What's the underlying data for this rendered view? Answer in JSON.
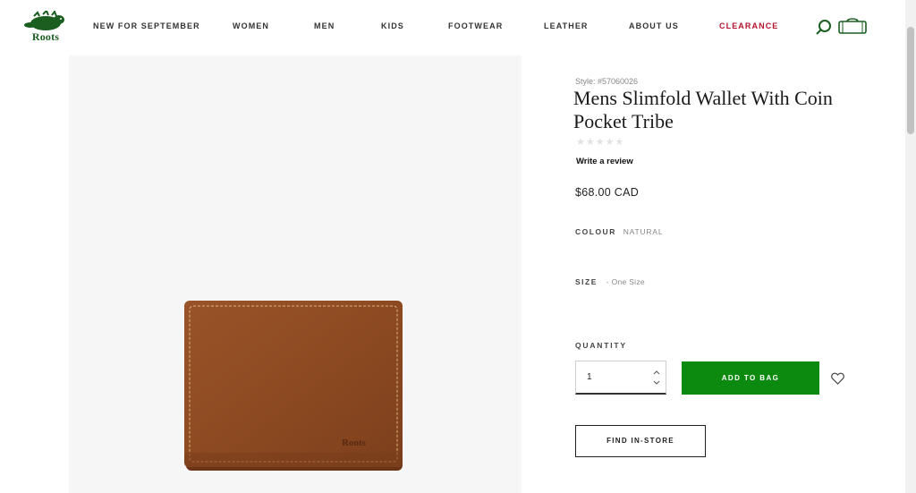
{
  "brand": {
    "logo_text": "Roots",
    "logo_color": "#1b5e20"
  },
  "nav": {
    "items": [
      {
        "label": "NEW FOR SEPTEMBER"
      },
      {
        "label": "WOMEN"
      },
      {
        "label": "MEN"
      },
      {
        "label": "KIDS"
      },
      {
        "label": "FOOTWEAR"
      },
      {
        "label": "LEATHER"
      },
      {
        "label": "ABOUT US"
      },
      {
        "label": "CLEARANCE"
      }
    ],
    "clearance_color": "#b2132e",
    "icons": [
      "search-icon",
      "shopping-bag-icon"
    ]
  },
  "product": {
    "style": "Style: #57060026",
    "title": "Mens Slimfold Wallet With Coin Pocket Tribe",
    "rating_stars": "★★★★★",
    "rating_value": 0,
    "write_review": "Write a review",
    "price": "$68.00 CAD",
    "colour_label": "COLOUR",
    "colour_value": "NATURAL",
    "size_label": "SIZE",
    "size_value": "- One Size",
    "quantity_label": "QUANTITY",
    "quantity_value": "1",
    "add_to_bag": "ADD TO BAG",
    "find_in_store": "FIND IN-STORE",
    "wallet_logo_text": "Roots",
    "accent_color": "#0c8a10"
  }
}
